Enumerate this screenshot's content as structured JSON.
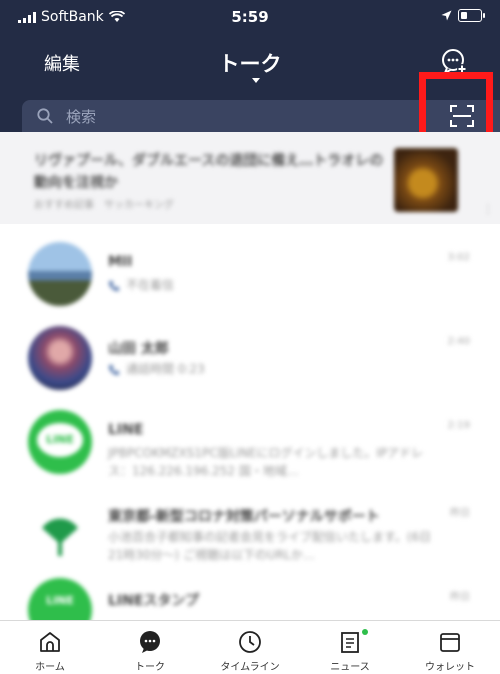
{
  "status_bar": {
    "carrier": "SoftBank",
    "time": "5:59"
  },
  "header": {
    "edit_label": "編集",
    "title": "トーク"
  },
  "search": {
    "placeholder": "検索"
  },
  "news": {
    "headline": "リヴァプール、ダブルエースの退団に備え…トラオレの動向を注視か",
    "subtitle": "おすすめ記事　サッカーキング"
  },
  "chats": [
    {
      "name": "MII",
      "preview": "不在着信",
      "time": "3:02"
    },
    {
      "name": "山田 太郎",
      "preview": "通話時間 0:23",
      "time": "2:40"
    },
    {
      "name": "LINE",
      "preview": "JPBPCOKMZXS1PC版LINEにログインしました。IPアドレス：126.226.196.252 国・地域…",
      "time": "2:19"
    },
    {
      "name": "東京都-新型コロナ対策パーソナルサポート",
      "preview": "小池百合子都知事の記者会見をライブ配信いたします。(6日21時30分～) ご視聴は以下のURLか…",
      "time": "昨日"
    },
    {
      "name": "LINEスタンプ",
      "preview": "",
      "time": "昨日"
    }
  ],
  "line_logo_text": "LINE",
  "tabs": [
    {
      "label": "ホーム",
      "icon": "home-icon"
    },
    {
      "label": "トーク",
      "icon": "chat-bubble-icon"
    },
    {
      "label": "タイムライン",
      "icon": "clock-icon"
    },
    {
      "label": "ニュース",
      "icon": "news-icon"
    },
    {
      "label": "ウォレット",
      "icon": "wallet-icon"
    }
  ],
  "colors": {
    "header_bg": "#232c45",
    "search_bg": "#3a4461",
    "line_green": "#2fbe4b",
    "highlight": "#ff1a1a"
  }
}
